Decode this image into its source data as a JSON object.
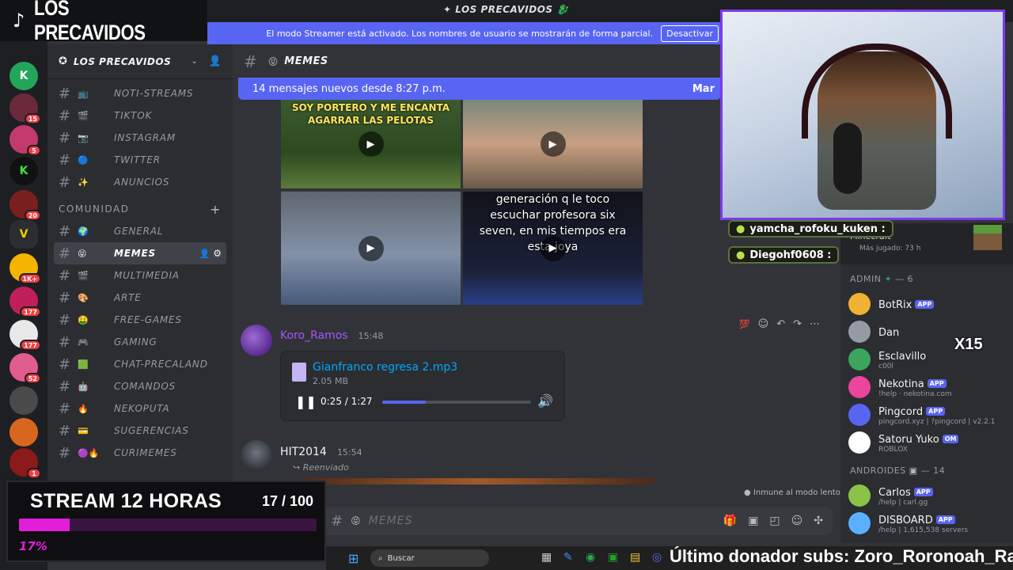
{
  "brand": {
    "name": "LOS PRECAVIDOS"
  },
  "window": {
    "title": "LOS PRECAVIDOS"
  },
  "streamer_bar": {
    "text": "El modo Streamer está activado. Los nombres de usuario se mostrarán de forma parcial.",
    "button": "Desactivar"
  },
  "server": {
    "name": "LOS PRECAVIDOS"
  },
  "rail_badges": [
    "15",
    "5",
    "20",
    "1K+",
    "177",
    "177",
    "52",
    "1"
  ],
  "channels_top": [
    {
      "emoji": "📺",
      "label": "NOTI-STREAMS"
    },
    {
      "emoji": "🎬",
      "label": "TIKTOK"
    },
    {
      "emoji": "📷",
      "label": "INSTAGRAM"
    },
    {
      "emoji": "🔵",
      "label": "TWITTER"
    },
    {
      "emoji": "✨",
      "label": "ANUNCIOS"
    }
  ],
  "category": {
    "label": "COMUNIDAD"
  },
  "channels_community": [
    {
      "emoji": "🌍",
      "label": "GENERAL"
    },
    {
      "emoji": "😝",
      "label": "MEMES"
    },
    {
      "emoji": "🎬",
      "label": "MULTIMEDIA"
    },
    {
      "emoji": "🎨",
      "label": "ARTE"
    },
    {
      "emoji": "🤑",
      "label": "FREE-GAMES"
    },
    {
      "emoji": "🎮",
      "label": "GAMING"
    },
    {
      "emoji": "🟩",
      "label": "CHAT-PRECALAND"
    },
    {
      "emoji": "🤖",
      "label": "COMANDOS"
    },
    {
      "emoji": "🔥",
      "label": "NEKOPUTA"
    },
    {
      "emoji": "💳",
      "label": "SUGERENCIAS"
    },
    {
      "emoji": "🟣🔥",
      "label": "CURIMEMES"
    }
  ],
  "chat": {
    "channel": "MEMES",
    "channel_emoji": "😝",
    "new_messages": "14 mensajes nuevos desde 8:27 p.m.",
    "new_messages_right": "Mar",
    "tiles": {
      "t1_caption": "SOY PORTERO Y ME ENCANTA AGARRAR LAS PELOTAS",
      "t4_caption": "generación q le toco escuchar profesora six seven, en mis tiempos era esta joya"
    },
    "messages": [
      {
        "author": "Koro_Ramos",
        "time": "15:48",
        "attachment": {
          "file": "Gianfranco regresa 2.mp3",
          "size": "2.05 MB",
          "position": "0:25 / 1:27",
          "progress": 0.29
        }
      },
      {
        "author": "HIT2014",
        "time": "15:54",
        "forwarded": "Reenviado"
      }
    ],
    "slow_mode": "Inmune al modo lento",
    "reaction": "💯"
  },
  "composer": {
    "placeholder": "MEMES",
    "emoji": "😝"
  },
  "overlay_chat": [
    {
      "user": "yamcha_rofoku_kuken :"
    },
    {
      "user": "Diegohf0608 :"
    }
  ],
  "activity": {
    "game": "Minecraft",
    "sub": "Más jugado: 73 h"
  },
  "members": {
    "admin_header": "ADMIN",
    "admin_count": "— 6",
    "admins": [
      {
        "name": "BotRix",
        "tag": "APP",
        "status": "",
        "color": "#f0b232"
      },
      {
        "name": "Dan",
        "tag": "",
        "status": "",
        "color": "#949ba4"
      },
      {
        "name": "Esclavillo",
        "tag": "",
        "status": "c00l",
        "color": "#3ba55c"
      },
      {
        "name": "Nekotina",
        "tag": "APP",
        "status": "!help · nekotina.com",
        "color": "#eb459e"
      },
      {
        "name": "Pingcord",
        "tag": "APP",
        "status": "pingcord.xyz | ?pingcord | v2.2.1",
        "color": "#5865f2"
      },
      {
        "name": "Satoru Yuko",
        "tag": "OM",
        "status": "ROBLOX",
        "color": "#ffffff"
      }
    ],
    "androids_header": "ANDROIDES",
    "androids_count": "— 14",
    "androids": [
      {
        "name": "Carlos",
        "tag": "APP",
        "status": "/help | carl.gg",
        "color": "#8bc34a"
      },
      {
        "name": "DISBOARD",
        "tag": "APP",
        "status": "/help | 1,615,538 servers",
        "color": "#5ab0ff"
      }
    ],
    "overlay_multiplier": "X15"
  },
  "goal": {
    "title": "STREAM 12 HORAS",
    "count": "17 / 100",
    "percent_label": "17%",
    "percent": 0.17
  },
  "taskbar": {
    "search": "Buscar"
  },
  "ticker": {
    "text": "Último donador subs: Zoro_Roronoah_Ramos"
  }
}
